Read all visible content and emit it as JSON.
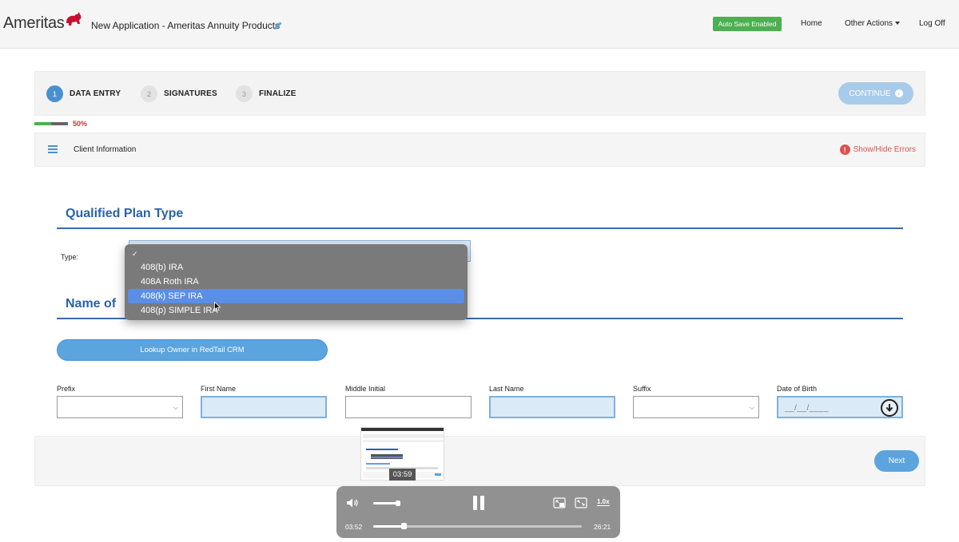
{
  "header": {
    "brand": "Ameritas",
    "app_title": "New Application - Ameritas Annuity Products",
    "autosave_label": "Auto Save Enabled",
    "nav": {
      "home": "Home",
      "other_actions": "Other Actions",
      "logoff": "Log Off"
    },
    "colors": {
      "autosave": "#4caf50",
      "brand_red": "#c8102e"
    }
  },
  "steps": [
    {
      "num": "1",
      "label": "DATA ENTRY",
      "active": true
    },
    {
      "num": "2",
      "label": "SIGNATURES",
      "active": false
    },
    {
      "num": "3",
      "label": "FINALIZE",
      "active": false
    }
  ],
  "continue_label": "CONTINUE",
  "progress": {
    "value": 0.5,
    "label": "50%"
  },
  "section": {
    "title": "Client Information",
    "errors_label": "Show/Hide Errors"
  },
  "qualified_plan": {
    "heading": "Qualified Plan Type",
    "type_label": "Type:",
    "dropdown": {
      "check_mark": "✓",
      "options": [
        "408(b) IRA",
        "408A Roth IRA",
        "408(k) SEP IRA",
        "408(p) SIMPLE IRA"
      ],
      "highlighted": "408(k) SEP IRA"
    }
  },
  "owner": {
    "heading": "Name of",
    "lookup_label": "Lookup Owner in RedTail CRM",
    "fields": {
      "prefix": "Prefix",
      "first_name": "First Name",
      "middle_initial": "Middle Initial",
      "last_name": "Last Name",
      "suffix": "Suffix",
      "dob": "Date of Birth",
      "dob_placeholder": "__/__/____"
    }
  },
  "next_label": "Next",
  "video": {
    "preview_time": "03:59",
    "current_time": "03:52",
    "total_time": "26:21",
    "speed": "1.0x",
    "progress": 0.147,
    "volume": 0.9
  }
}
